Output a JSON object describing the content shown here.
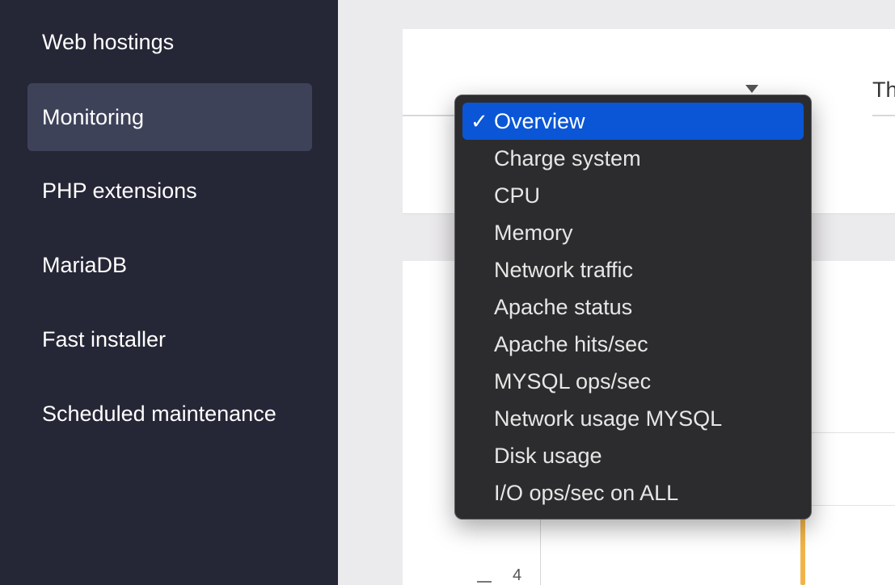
{
  "sidebar": {
    "items": [
      {
        "label": "Web hostings",
        "active": false
      },
      {
        "label": "Monitoring",
        "active": true
      },
      {
        "label": "PHP extensions",
        "active": false
      },
      {
        "label": "MariaDB",
        "active": false
      },
      {
        "label": "Fast installer",
        "active": false
      },
      {
        "label": "Scheduled maintenance",
        "active": false
      }
    ]
  },
  "main": {
    "right_tab_label": "Th",
    "chart": {
      "tick_label": "4"
    }
  },
  "dropdown": {
    "check_glyph": "✓",
    "selected_index": 0,
    "options": [
      "Overview",
      "Charge system",
      "CPU",
      "Memory",
      "Network traffic",
      "Apache status",
      "Apache hits/sec",
      "MYSQL ops/sec",
      "Network usage MYSQL",
      "Disk usage",
      "I/O ops/sec on ALL"
    ]
  },
  "colors": {
    "sidebar_bg": "#252636",
    "sidebar_active_bg": "#3e4259",
    "menu_bg": "#2c2c2e",
    "menu_selected_bg": "#0a56d6",
    "chart_accent": "#f2b44a"
  },
  "icons": {
    "select_arrow": "caret-down-icon",
    "check": "checkmark-icon"
  }
}
